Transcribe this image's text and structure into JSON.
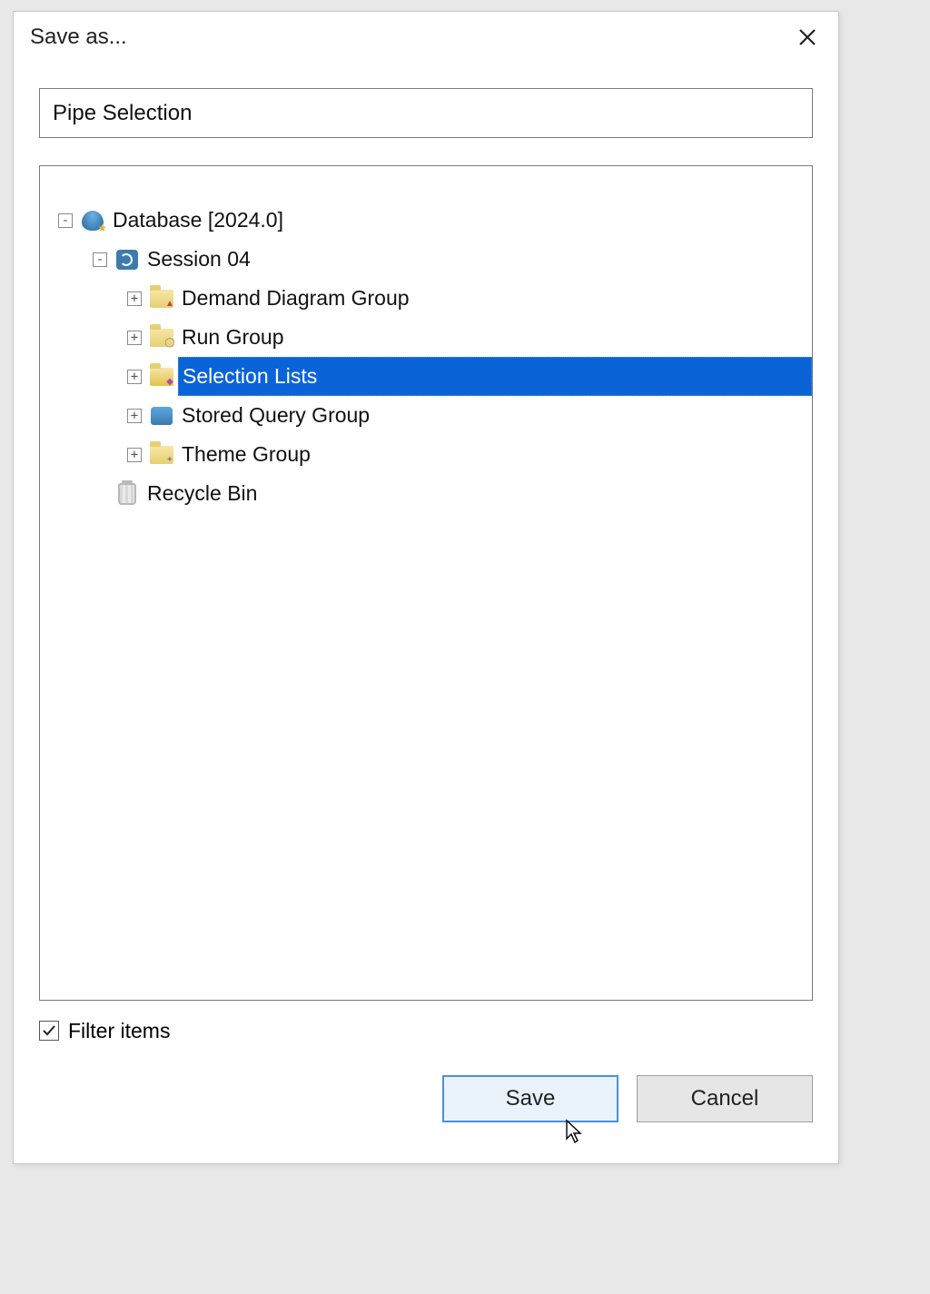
{
  "dialog": {
    "title": "Save as...",
    "name_value": "Pipe Selection",
    "filter_label": "Filter items",
    "filter_checked": true,
    "save_label": "Save",
    "cancel_label": "Cancel"
  },
  "tree": {
    "root": {
      "label": "Database [2024.0]",
      "expanded": true
    },
    "session": {
      "label": "Session 04",
      "expanded": true
    },
    "items": [
      {
        "label": "Demand Diagram Group",
        "icon": "folder-demand",
        "selected": false
      },
      {
        "label": "Run Group",
        "icon": "folder-run",
        "selected": false
      },
      {
        "label": "Selection Lists",
        "icon": "folder-sel",
        "selected": true
      },
      {
        "label": "Stored Query Group",
        "icon": "storedq",
        "selected": false
      },
      {
        "label": "Theme Group",
        "icon": "folder-theme",
        "selected": false
      }
    ],
    "recycle": {
      "label": "Recycle Bin"
    }
  }
}
